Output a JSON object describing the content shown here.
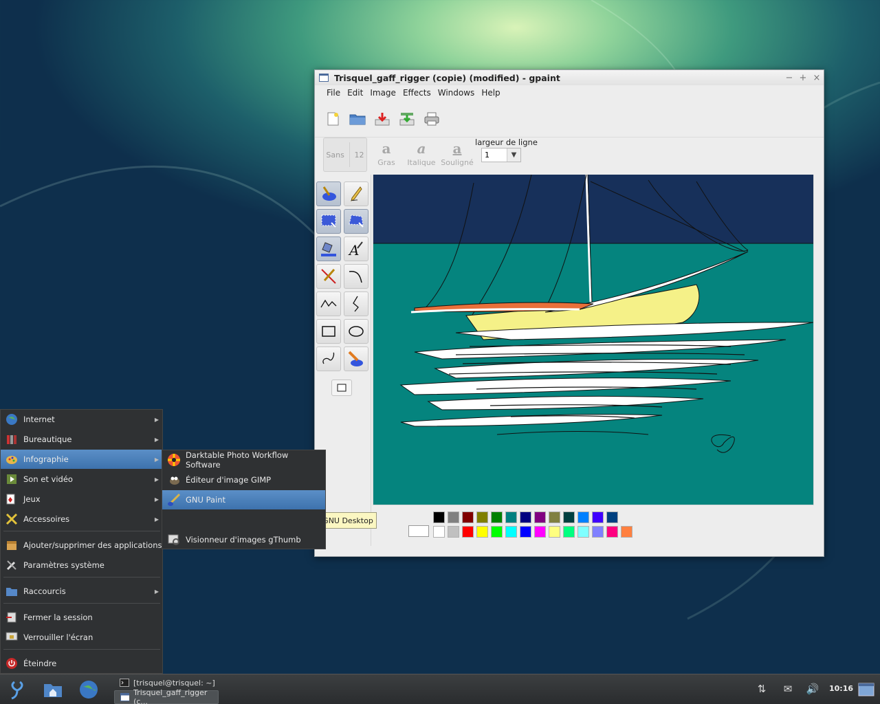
{
  "window": {
    "title": "Trisquel_gaff_rigger (copie) (modified) - gpaint",
    "controls": [
      "−",
      "+",
      "×"
    ]
  },
  "menubar": [
    "File",
    "Edit",
    "Image",
    "Effects",
    "Windows",
    "Help"
  ],
  "toolbar": {
    "icons": [
      "new-file-icon",
      "open-folder-icon",
      "save-icon",
      "save-as-icon",
      "print-icon"
    ]
  },
  "text_toolbar": {
    "font_name": "Sans",
    "font_size": "12",
    "bold": "Gras",
    "italic": "Italique",
    "underline": "Souligné",
    "line_width_label": "largeur de ligne",
    "line_width_value": "1"
  },
  "tools": [
    "paintbrush-tool",
    "pencil-tool",
    "rect-select-tool",
    "freehand-select-tool",
    "fill-tool",
    "text-tool",
    "line-tool",
    "curve-tool",
    "multiline-tool",
    "bezier-tool",
    "rectangle-tool",
    "ellipse-tool",
    "freehand-shape-tool",
    "eraser-tool"
  ],
  "palette": {
    "row1": [
      "#000000",
      "#808080",
      "#800000",
      "#808000",
      "#008000",
      "#008080",
      "#000080",
      "#800080",
      "#808040",
      "#004040",
      "#0080ff",
      "#4000ff",
      "#004080"
    ],
    "row2": [
      "#ffffff",
      "#c0c0c0",
      "#ff0000",
      "#ffff00",
      "#00ff00",
      "#00ffff",
      "#0000ff",
      "#ff00ff",
      "#ffff80",
      "#00ff80",
      "#80ffff",
      "#8080ff",
      "#ff0080",
      "#ff8040"
    ]
  },
  "start_menu": {
    "items": [
      {
        "label": "Internet",
        "icon": "globe-icon",
        "submenu": true
      },
      {
        "label": "Bureautique",
        "icon": "office-icon",
        "submenu": true
      },
      {
        "label": "Infographie",
        "icon": "graphics-icon",
        "submenu": true,
        "highlighted": true
      },
      {
        "label": "Son et vidéo",
        "icon": "multimedia-icon",
        "submenu": true
      },
      {
        "label": "Jeux",
        "icon": "games-icon",
        "submenu": true
      },
      {
        "label": "Accessoires",
        "icon": "accessories-icon",
        "submenu": true
      },
      {
        "label": "Ajouter/supprimer des applications",
        "icon": "package-icon",
        "submenu": false
      },
      {
        "label": "Paramètres système",
        "icon": "settings-icon",
        "submenu": false
      },
      {
        "label": "Raccourcis",
        "icon": "folder-icon",
        "submenu": true
      },
      {
        "label": "Fermer la session",
        "icon": "logout-icon",
        "submenu": false
      },
      {
        "label": "Verrouiller l'écran",
        "icon": "lock-screen-icon",
        "submenu": false
      },
      {
        "label": "Éteindre",
        "icon": "power-icon",
        "submenu": false
      }
    ]
  },
  "submenu": {
    "items": [
      {
        "label": "Darktable Photo Workflow Software",
        "icon": "darktable-icon"
      },
      {
        "label": "Éditeur d'image GIMP",
        "icon": "gimp-icon"
      },
      {
        "label": "GNU Paint",
        "icon": "gpaint-icon",
        "highlighted": true
      },
      {
        "label": "Visionneur d'images gThumb",
        "icon": "gthumb-icon"
      }
    ]
  },
  "tooltip": "A small-scale painting program for GNOME, the GNU Desktop",
  "taskbar": {
    "tasks": [
      {
        "label": "[trisquel@trisquel: ~]",
        "icon": "terminal-icon"
      },
      {
        "label": "Trisquel_gaff_rigger (c...",
        "icon": "gpaint-window-icon"
      }
    ],
    "clock": "10:16"
  }
}
